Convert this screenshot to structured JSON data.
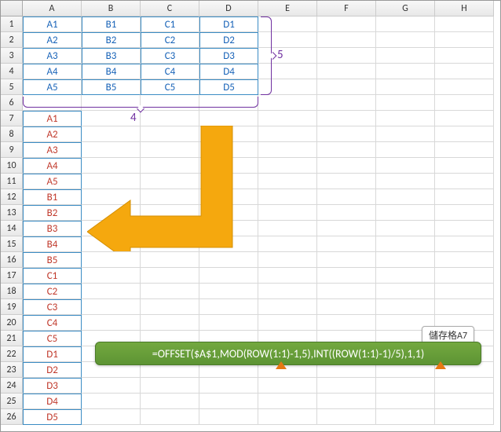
{
  "cols": [
    "A",
    "B",
    "C",
    "D",
    "E",
    "F",
    "G",
    "H"
  ],
  "rows": [
    "1",
    "2",
    "3",
    "4",
    "5",
    "6",
    "7",
    "8",
    "9",
    "10",
    "11",
    "12",
    "13",
    "14",
    "15",
    "16",
    "17",
    "18",
    "19",
    "20",
    "21",
    "22",
    "23",
    "24",
    "25",
    "26"
  ],
  "table": [
    [
      "A1",
      "B1",
      "C1",
      "D1"
    ],
    [
      "A2",
      "B2",
      "C2",
      "D2"
    ],
    [
      "A3",
      "B3",
      "C3",
      "D3"
    ],
    [
      "A4",
      "B4",
      "C4",
      "D4"
    ],
    [
      "A5",
      "B5",
      "C5",
      "D5"
    ]
  ],
  "list": [
    "A1",
    "A2",
    "A3",
    "A4",
    "A5",
    "B1",
    "B2",
    "B3",
    "B4",
    "B5",
    "C1",
    "C2",
    "C3",
    "C4",
    "C5",
    "D1",
    "D2",
    "D3",
    "D4",
    "D5"
  ],
  "brace_cols": "4",
  "brace_rows": "5",
  "formula": "=OFFSET($A$1,MOD(ROW(1:1)-1,5),INT((ROW(1:1)-1)/5),1,1)",
  "tag": "儲存格A7"
}
